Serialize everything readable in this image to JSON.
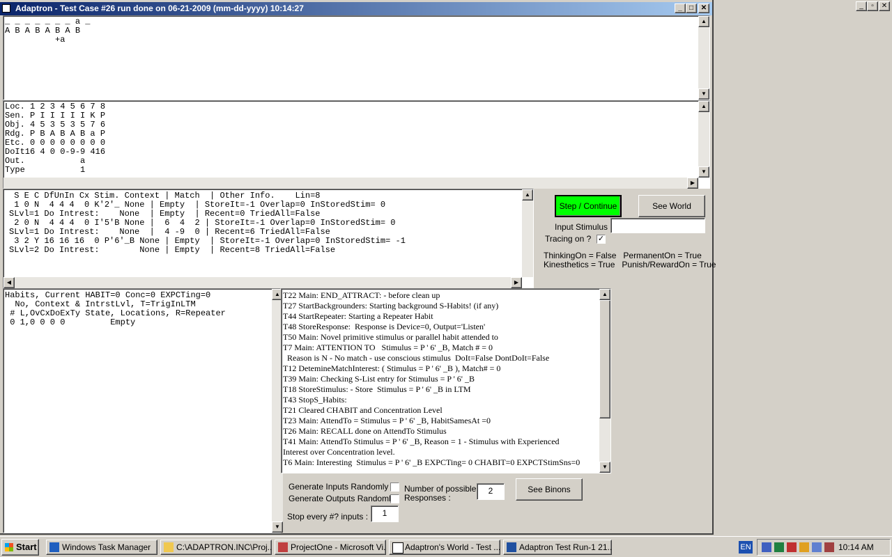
{
  "window": {
    "title": "Adaptron - Test Case #26 run done on 06-21-2009 (mm-dd-yyyy) 10:14:27"
  },
  "colors": {
    "title_start": "#0a246a",
    "title_end": "#a6caf0",
    "step_button": "#00ff00"
  },
  "panels": {
    "sequence": "_ _ _ _ _ _ _ a _\nA B A B A B A B\n          +a",
    "locations": "Loc. 1 2 3 4 5 6 7 8\nSen. P I I I I I K P\nObj. 4 5 3 5 3 5 7 6\nRdg. P B A B A B a P\nEtc. 0 0 0 0 0 0 0 0\nDoIt16 4 0 0-9-9 416\nOut.           a\nType           1",
    "stimuli": " S E C DfUnIn Cx Stim. Context | Match  | Other Info.    Lin=8\n 1 0 N  4 4 4  0 K'2'_ None | Empty  | StoreIt=-1 Overlap=0 InStoredStim= 0\nSLvl=1 Do Intrest:    None  | Empty  | Recent=0 TriedAll=False\n 2 0 N  4 4 4  0 I'5'B None |  6  4  2 | StoreIt=-1 Overlap=0 InStoredStim= 0\nSLvl=1 Do Intrest:    None  |  4 -9  0 | Recent=6 TriedAll=False\n 3 2 Y 16 16 16  0 P'6'_B None | Empty  | StoreIt=-1 Overlap=0 InStoredStim= -1\nSLvl=2 Do Intrest:        None | Empty  | Recent=8 TriedAll=False",
    "habits": "Habits, Current HABIT=0 Conc=0 EXPCTing=0\n  No, Context & IntrstLvl, T=TrigInLTM\n # L,OvCxDoExTy State, Locations, R=Repeater\n 0 1,0 0 0 0         Empty"
  },
  "log": [
    "T22 Main: END_ATTRACT: - before clean up",
    "T27 StartBackgrounders: Starting background S-Habits! (if any)",
    "T44 StartRepeater: Starting a Repeater Habit",
    "T48 StoreResponse:  Response is Device=0, Output='Listen'",
    "T50 Main: Novel primitive stimulus or parallel habit attended to",
    "T7 Main: ATTENTION TO   Stimulus = P ' 6' _B, Match # = 0",
    "  Reason is N - No match - use conscious stimulus  DoIt=False DontDoIt=False",
    "T12 DetemineMatchInterest: ( Stimulus = P ' 6' _B ), Match# = 0",
    "T39 Main: Checking S-List entry for Stimulus = P ' 6' _B",
    "T18 StoreStimulus: - Store  Stimulus = P ' 6' _B in LTM",
    "T43 StopS_Habits:",
    "T21 Cleared CHABIT and Concentration Level",
    "T23 Main: AttendTo = Stimulus = P ' 6' _B, HabitSamesAt =0",
    "T26 Main: RECALL done on AttendTo Stimulus",
    "T41 Main: AttendTo Stimulus = P ' 6' _B, Reason = 1 - Stimulus with Experienced",
    "Interest over Concentration level.",
    "T6 Main: Interesting  Stimulus = P ' 6' _B EXPCTing= 0 CHABIT=0 EXPCTStimSns=0"
  ],
  "controls": {
    "step_label": "Step / Continue",
    "see_world_label": "See World",
    "input_stimulus_label": "Input Stimulus :",
    "input_stimulus_value": "",
    "tracing_label": "Tracing on ?",
    "tracing_checked": "✓",
    "status_line1": "ThinkingOn = False   PermanentOn = True",
    "status_line2": "Kinesthetics = True   Punish/RewardOn = True",
    "gen_inputs_label": "Generate Inputs Randomly ?",
    "gen_outputs_label": "Generate Outputs Randomly?",
    "num_responses_label1": "Number of possible",
    "num_responses_label2": "Responses :",
    "num_responses_value": "2",
    "see_binons_label": "See Binons",
    "stop_every_label": "Stop every #? inputs :",
    "stop_every_value": "1"
  },
  "taskbar": {
    "start_label": "Start",
    "tasks": [
      "Windows Task Manager",
      "C:\\ADAPTRON.INC\\Proj...",
      "ProjectOne - Microsoft Vi...",
      "Adaptron's World - Test ...",
      "Adaptron Test Run-1 21..."
    ],
    "language": "EN",
    "clock": "10:14 AM"
  }
}
